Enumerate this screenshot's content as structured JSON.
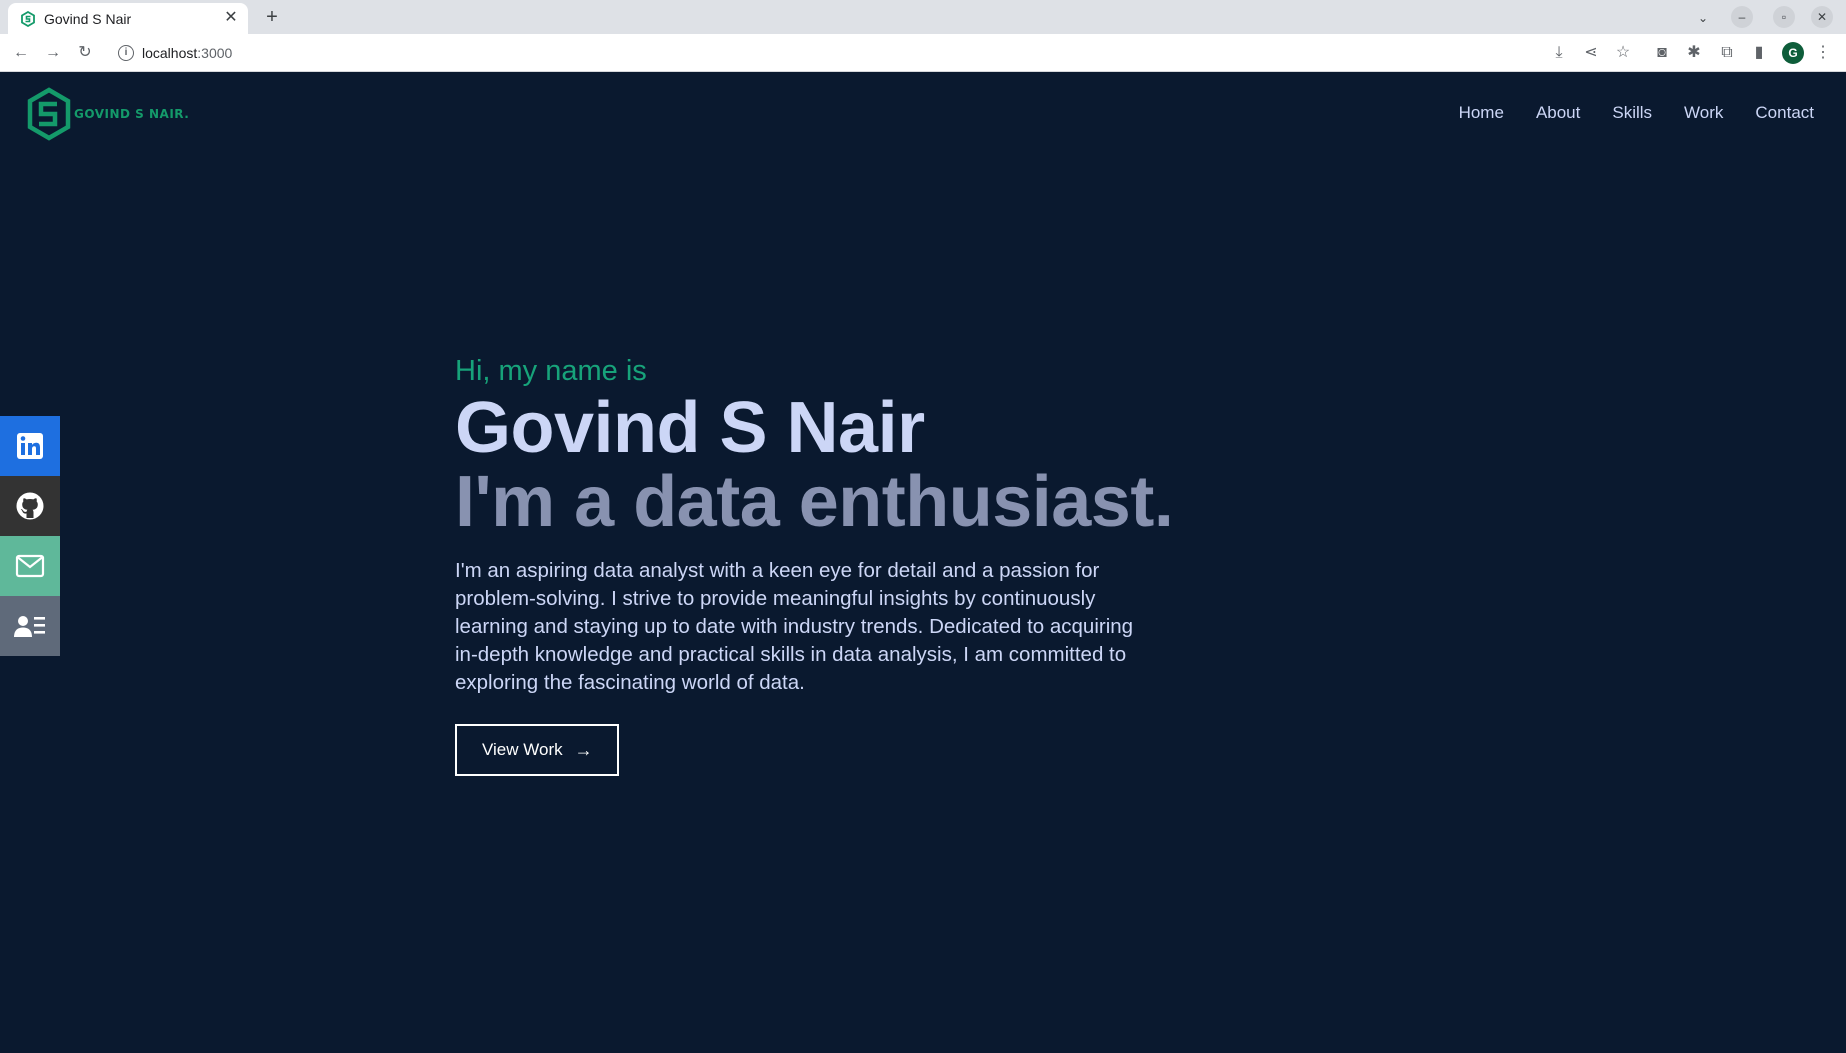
{
  "browser": {
    "tab_title": "Govind S Nair",
    "tab_close": "✕",
    "new_tab": "+",
    "url_host": "localhost",
    "url_port": ":3000",
    "profile_initial": "G"
  },
  "site": {
    "logo_text": "GOVIND S NAIR.",
    "accent_color": "#149a6a",
    "background_color": "#0a192f",
    "nav": [
      {
        "label": "Home"
      },
      {
        "label": "About"
      },
      {
        "label": "Skills"
      },
      {
        "label": "Work"
      },
      {
        "label": "Contact"
      }
    ],
    "social": [
      {
        "icon": "linkedin-icon",
        "color": "#1e6fe0"
      },
      {
        "icon": "github-icon",
        "color": "#333333"
      },
      {
        "icon": "mail-icon",
        "color": "#5fb89a"
      },
      {
        "icon": "resume-icon",
        "color": "#5f6a7a"
      }
    ]
  },
  "hero": {
    "greeting": "Hi, my name is",
    "name": "Govind S Nair",
    "tagline": "I'm a data enthusiast.",
    "bio": "I'm an aspiring data analyst with a keen eye for detail and a passion for problem-solving. I strive to provide meaningful insights by continuously learning and staying up to date with industry trends. Dedicated to acquiring in-depth knowledge and practical skills in data analysis, I am committed to exploring the fascinating world of data.",
    "cta_label": "View Work",
    "cta_arrow": "→"
  }
}
